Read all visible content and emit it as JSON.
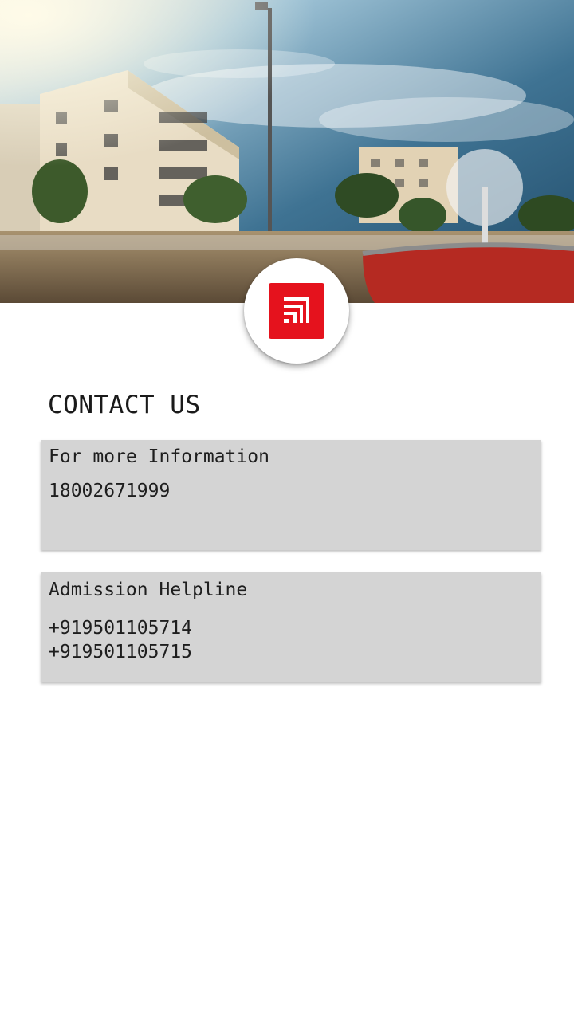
{
  "header": {
    "logo_alt": "college-logo",
    "accent_color": "#e5121d"
  },
  "contact": {
    "title": "CONTACT US",
    "cards": [
      {
        "heading": "For more Information",
        "lines": [
          "18002671999"
        ]
      },
      {
        "heading": "Admission Helpline",
        "lines": [
          "+919501105714",
          "+919501105715"
        ]
      }
    ]
  }
}
